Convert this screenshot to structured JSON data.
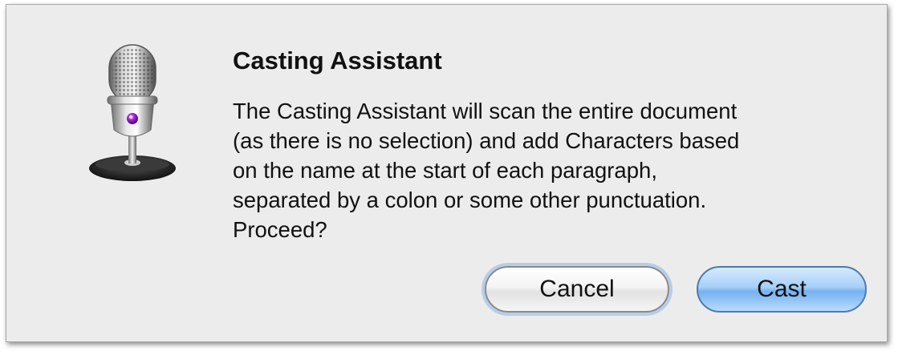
{
  "dialog": {
    "title": "Casting Assistant",
    "message": "The Casting Assistant will scan the entire document\n(as there is no selection) and add Characters based\non the name at the start of each paragraph,\nseparated by a colon or some other punctuation.\nProceed?",
    "icon": "microphone-icon",
    "buttons": {
      "cancel_label": "Cancel",
      "cast_label": "Cast"
    }
  },
  "colors": {
    "dialog_background": "#ececec",
    "default_button": "#76b1ef",
    "focus_ring": "#8cb4e6"
  }
}
